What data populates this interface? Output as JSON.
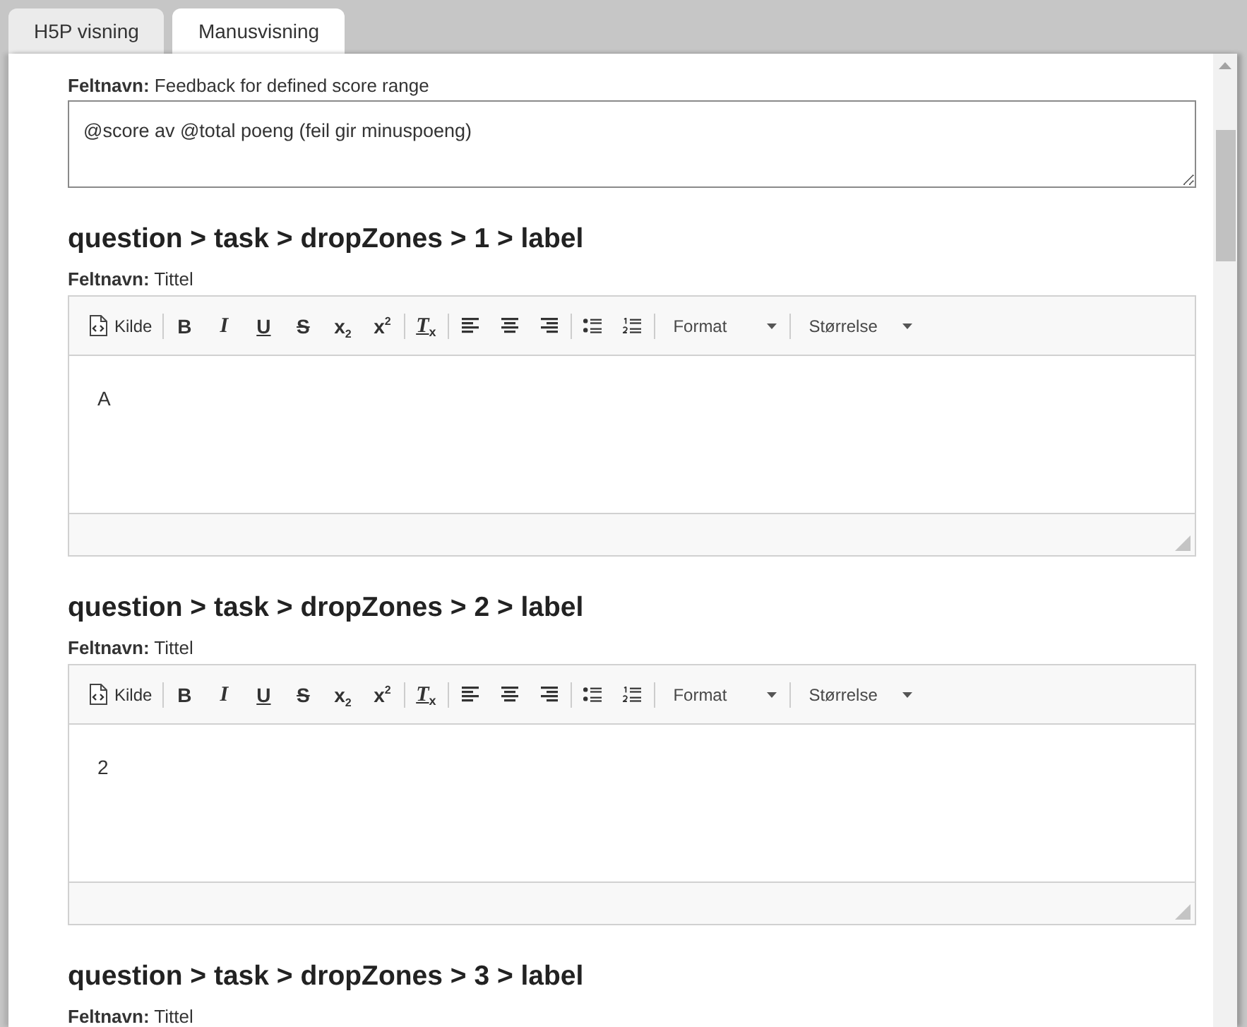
{
  "tabs": [
    {
      "label": "H5P visning",
      "selected": false
    },
    {
      "label": "Manusvisning",
      "selected": true
    }
  ],
  "fields": [
    {
      "kind": "textarea",
      "label": "**Feltnavn:** Feedback for defined score range",
      "value": "@score av @total poeng (feil gir minuspoeng)"
    },
    {
      "kind": "rich_editor",
      "heading": "question > task > dropZones > 1 > label",
      "label": "**Feltnavn:** Tittel",
      "toolbar": [
        [
          {
            "kind": "source",
            "label": "Kilde"
          }
        ],
        [
          {
            "kind": "bold",
            "label": "B"
          },
          {
            "kind": "italic",
            "label": "I"
          },
          {
            "kind": "underline",
            "label": "U"
          },
          {
            "kind": "strike",
            "label": "S"
          },
          {
            "kind": "subscript",
            "label": "x$_{2}$"
          },
          {
            "kind": "superscript",
            "label": "x$^{2}$"
          }
        ],
        [
          {
            "kind": "remove_format",
            "label": "T$_{x}$"
          }
        ],
        [
          {
            "kind": "align_left"
          },
          {
            "kind": "align_center"
          },
          {
            "kind": "align_right"
          }
        ],
        [
          {
            "kind": "bullet_list"
          },
          {
            "kind": "numbered_list"
          }
        ],
        [
          {
            "kind": "combo",
            "label": "Format"
          }
        ],
        [
          {
            "kind": "combo",
            "label": "Størrelse"
          }
        ]
      ],
      "value": "A"
    },
    {
      "kind": "rich_editor",
      "heading": "question > task > dropZones > 2 > label",
      "label": "**Feltnavn:** Tittel",
      "toolbar": [
        [
          {
            "kind": "source",
            "label": "Kilde"
          }
        ],
        [
          {
            "kind": "bold",
            "label": "B"
          },
          {
            "kind": "italic",
            "label": "I"
          },
          {
            "kind": "underline",
            "label": "U"
          },
          {
            "kind": "strike",
            "label": "S"
          },
          {
            "kind": "subscript",
            "label": "x$_{2}$"
          },
          {
            "kind": "superscript",
            "label": "x$^{2}$"
          }
        ],
        [
          {
            "kind": "remove_format",
            "label": "T$_{x}$"
          }
        ],
        [
          {
            "kind": "align_left"
          },
          {
            "kind": "align_center"
          },
          {
            "kind": "align_right"
          }
        ],
        [
          {
            "kind": "bullet_list"
          },
          {
            "kind": "numbered_list"
          }
        ],
        [
          {
            "kind": "combo",
            "label": "Format"
          }
        ],
        [
          {
            "kind": "combo",
            "label": "Størrelse"
          }
        ]
      ],
      "value": "2"
    },
    {
      "kind": "rich_editor",
      "heading": "question > task > dropZones > 3 > label",
      "label": "**Feltnavn:** Tittel"
    }
  ]
}
